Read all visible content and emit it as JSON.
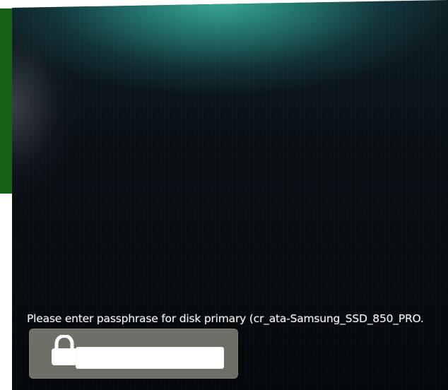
{
  "screen": {
    "prompt": "Please enter passphrase for disk primary (cr_ata-Samsung_SSD_850_PRO.",
    "password_value": ""
  },
  "icons": {
    "lock": "lock-icon"
  },
  "colors": {
    "background": "#05080b",
    "teal_glow": "#3ab29b",
    "side_panel": "#146216",
    "prompt_text": "#f2f2f2",
    "password_box": "#6f6f68",
    "input": "#ffffff"
  }
}
